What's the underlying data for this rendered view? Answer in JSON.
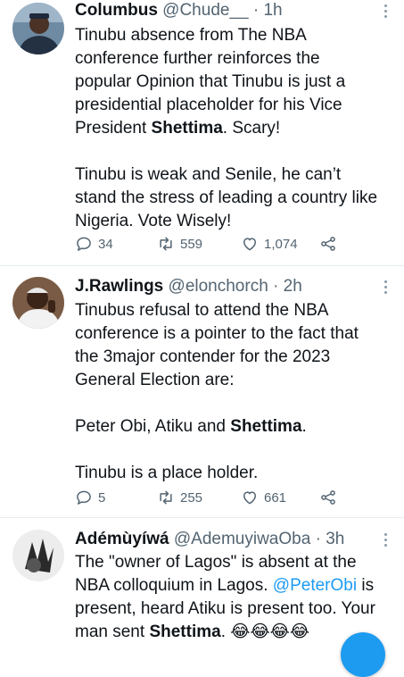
{
  "tweets": [
    {
      "name": "Columbus",
      "handle": "@Chude__",
      "sep": "·",
      "time": "1h",
      "p1_a": "Tinubu absence from The NBA",
      "p1_b": "conference further reinforces the",
      "p1_c": "popular Opinion that Tinubu is just a",
      "p1_d": "presidential placeholder for his Vice",
      "p1_e_pre": "President ",
      "p1_e_bold": "Shettima",
      "p1_e_post": ". Scary!",
      "p2_a": "Tinubu is weak and Senile, he can’t",
      "p2_b": "stand the stress of leading a country like",
      "p2_c": "Nigeria. Vote Wisely!",
      "replies": "34",
      "retweets": "559",
      "likes": "1,074",
      "avatar_icon": "user-avatar-photo"
    },
    {
      "name": "J.Rawlings",
      "handle": "@elonchorch",
      "sep": "·",
      "time": "2h",
      "p1_a": "Tinubus refusal to attend the NBA",
      "p1_b": "conference is a pointer to the fact that",
      "p1_c": "the 3major contender for the 2023",
      "p1_d": "General Election are:",
      "p2_pre": "Peter Obi, Atiku and ",
      "p2_bold": "Shettima",
      "p2_post": ".",
      "p3": "Tinubu is a place holder.",
      "replies": "5",
      "retweets": "255",
      "likes": "661",
      "avatar_icon": "user-avatar-photo"
    },
    {
      "name": "Adémùyíwá",
      "handle": "@AdemuyiwaOba",
      "sep": "·",
      "time": "3h",
      "l1": "The \"owner of Lagos\" is absent at the",
      "l2_pre": "NBA colloquium in Lagos. ",
      "l2_link": "@PeterObi",
      "l2_post": " is",
      "l3": "present, heard Atiku is present too. Your",
      "l4_pre": "man sent ",
      "l4_bold": "Shettima",
      "l4_post": ". ",
      "emoji": "😂😂😂😂",
      "avatar_icon": "user-avatar-photo"
    }
  ],
  "icons": {
    "reply": "reply-icon",
    "retweet": "retweet-icon",
    "like": "heart-icon",
    "share": "share-icon",
    "more": "more-options-icon",
    "compose": "compose-button"
  },
  "colors": {
    "accent": "#1d9bf0",
    "muted": "#536471",
    "divider": "#e6ecf0"
  }
}
